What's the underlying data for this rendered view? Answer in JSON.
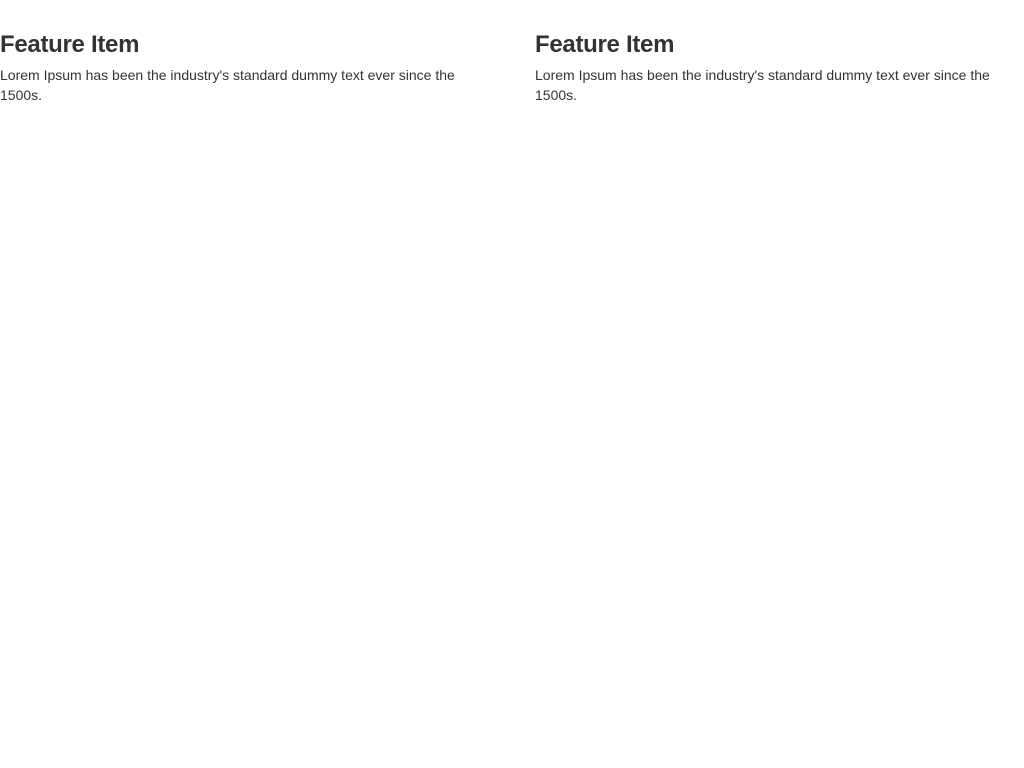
{
  "features": [
    {
      "title": "Feature Item",
      "text": "Lorem Ipsum has been the industry's standard dummy text ever since the 1500s."
    },
    {
      "title": "Feature Item",
      "text": "Lorem Ipsum has been the industry's standard dummy text ever since the 1500s."
    }
  ],
  "colors": {
    "background": "#ffffff",
    "text": "#333333"
  }
}
